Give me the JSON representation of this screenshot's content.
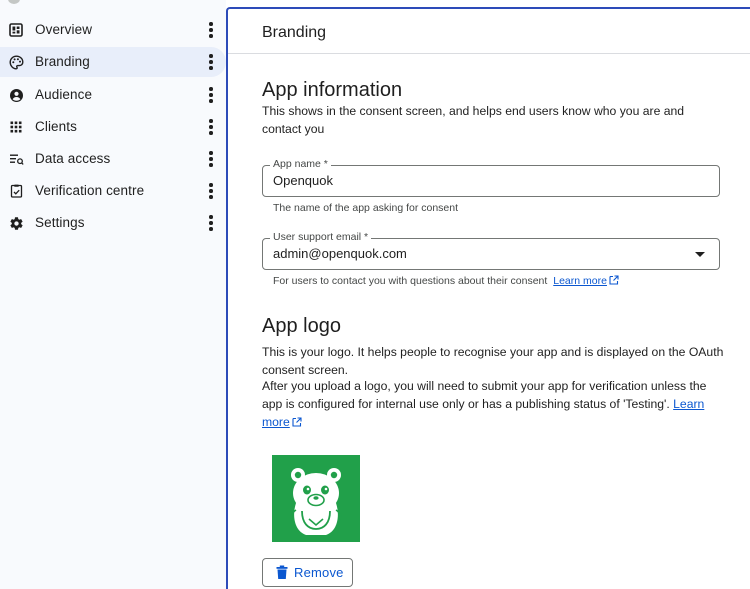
{
  "sidebar": {
    "items": [
      {
        "label": "Overview",
        "icon": "dashboard-icon"
      },
      {
        "label": "Branding",
        "icon": "palette-icon",
        "active": true
      },
      {
        "label": "Audience",
        "icon": "person-icon"
      },
      {
        "label": "Clients",
        "icon": "apps-grid-icon"
      },
      {
        "label": "Data access",
        "icon": "data-list-icon"
      },
      {
        "label": "Verification centre",
        "icon": "verified-checklist-icon"
      },
      {
        "label": "Settings",
        "icon": "gear-icon"
      }
    ]
  },
  "header": {
    "title": "Branding"
  },
  "app_information": {
    "title": "App information",
    "description": "This shows in the consent screen, and helps end users know who you are and contact you",
    "app_name": {
      "label": "App name *",
      "value": "Openquok",
      "hint": "The name of the app asking for consent"
    },
    "support_email": {
      "label": "User support email *",
      "value": "admin@openquok.com",
      "hint": "For users to contact you with questions about their consent",
      "hint_link": "Learn more"
    }
  },
  "app_logo": {
    "title": "App logo",
    "description_1": "This is your logo. It helps people to recognise your app and is displayed on the OAuth consent screen.",
    "description_2": "After you upload a logo, you will need to submit your app for verification unless the app is configured for internal use only or has a publishing status of 'Testing'.",
    "learn_more": "Learn more",
    "logo_background": "#21a04a",
    "remove_label": "Remove"
  },
  "colors": {
    "accent": "#0b57d0",
    "frame_border": "#2d4bb9",
    "sidebar_active": "#e8eefa"
  }
}
